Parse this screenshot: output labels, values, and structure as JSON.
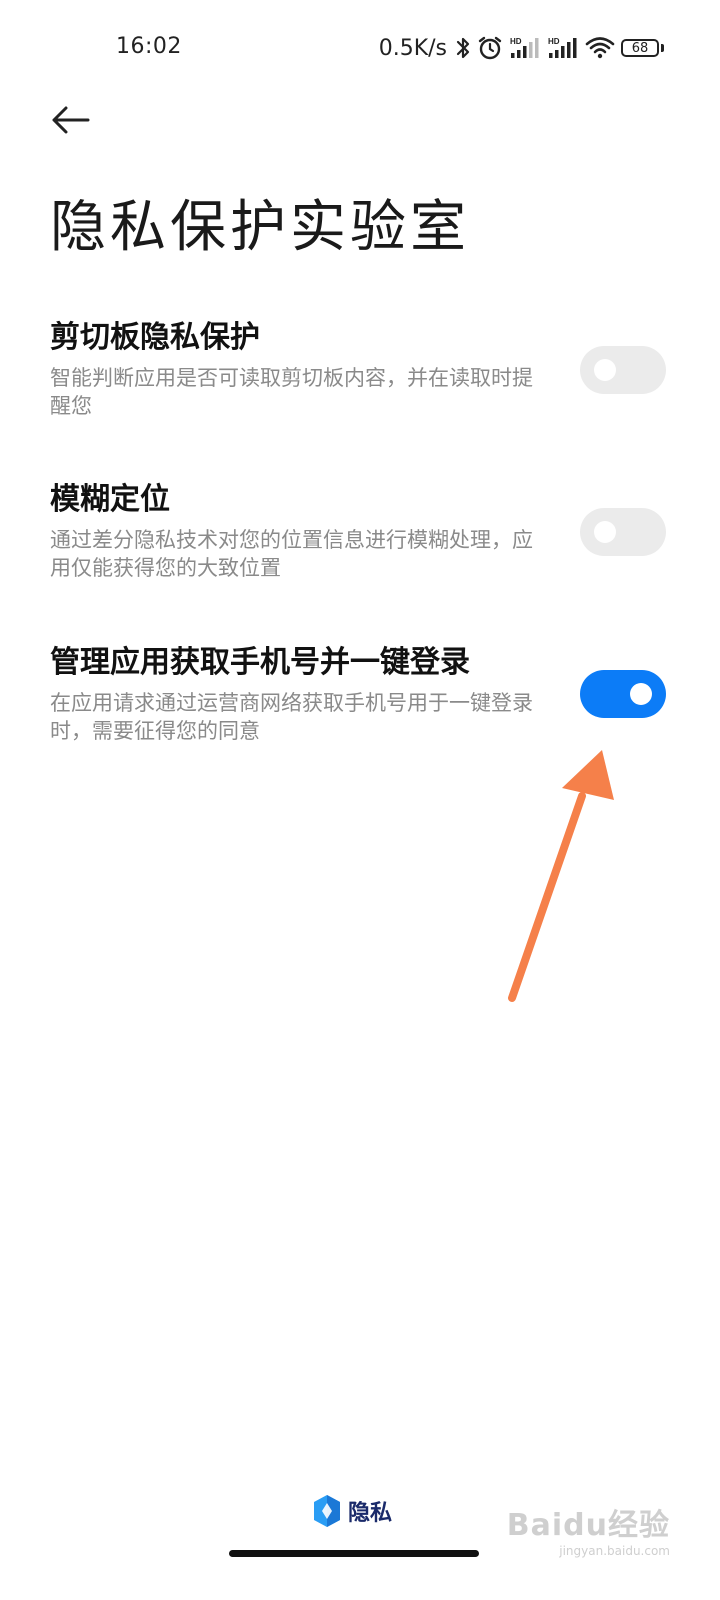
{
  "status_bar": {
    "time": "16:02",
    "net_speed": "0.5K/s",
    "signal_1_label": "HD",
    "signal_2_label": "HD",
    "battery": "68",
    "icons": [
      "bluetooth-icon",
      "alarm-icon",
      "signal-icon",
      "signal-icon",
      "wifi-icon",
      "battery-icon"
    ]
  },
  "header": {
    "back_icon": "back-arrow-icon",
    "title": "隐私保护实验室"
  },
  "settings": [
    {
      "title": "剪切板隐私保护",
      "description": "智能判断应用是否可读取剪切板内容，并在读取时提醒您",
      "enabled": false
    },
    {
      "title": "模糊定位",
      "description": "通过差分隐私技术对您的位置信息进行模糊处理，应用仅能获得您的大致位置",
      "enabled": false
    },
    {
      "title": "管理应用获取手机号并一键登录",
      "description": "在应用请求通过运营商网络获取手机号用于一键登录时，需要征得您的同意",
      "enabled": true
    }
  ],
  "colors": {
    "toggle_on": "#0c7cf7",
    "toggle_off": "#ebebeb",
    "annotation_arrow": "#f5804a",
    "brand_icon": "#2a9df4"
  },
  "brand": {
    "icon": "privacy-shield-icon",
    "label": "隐私"
  },
  "watermark": {
    "logo_text": "Baidu经验",
    "url": "jingyan.baidu.com"
  }
}
